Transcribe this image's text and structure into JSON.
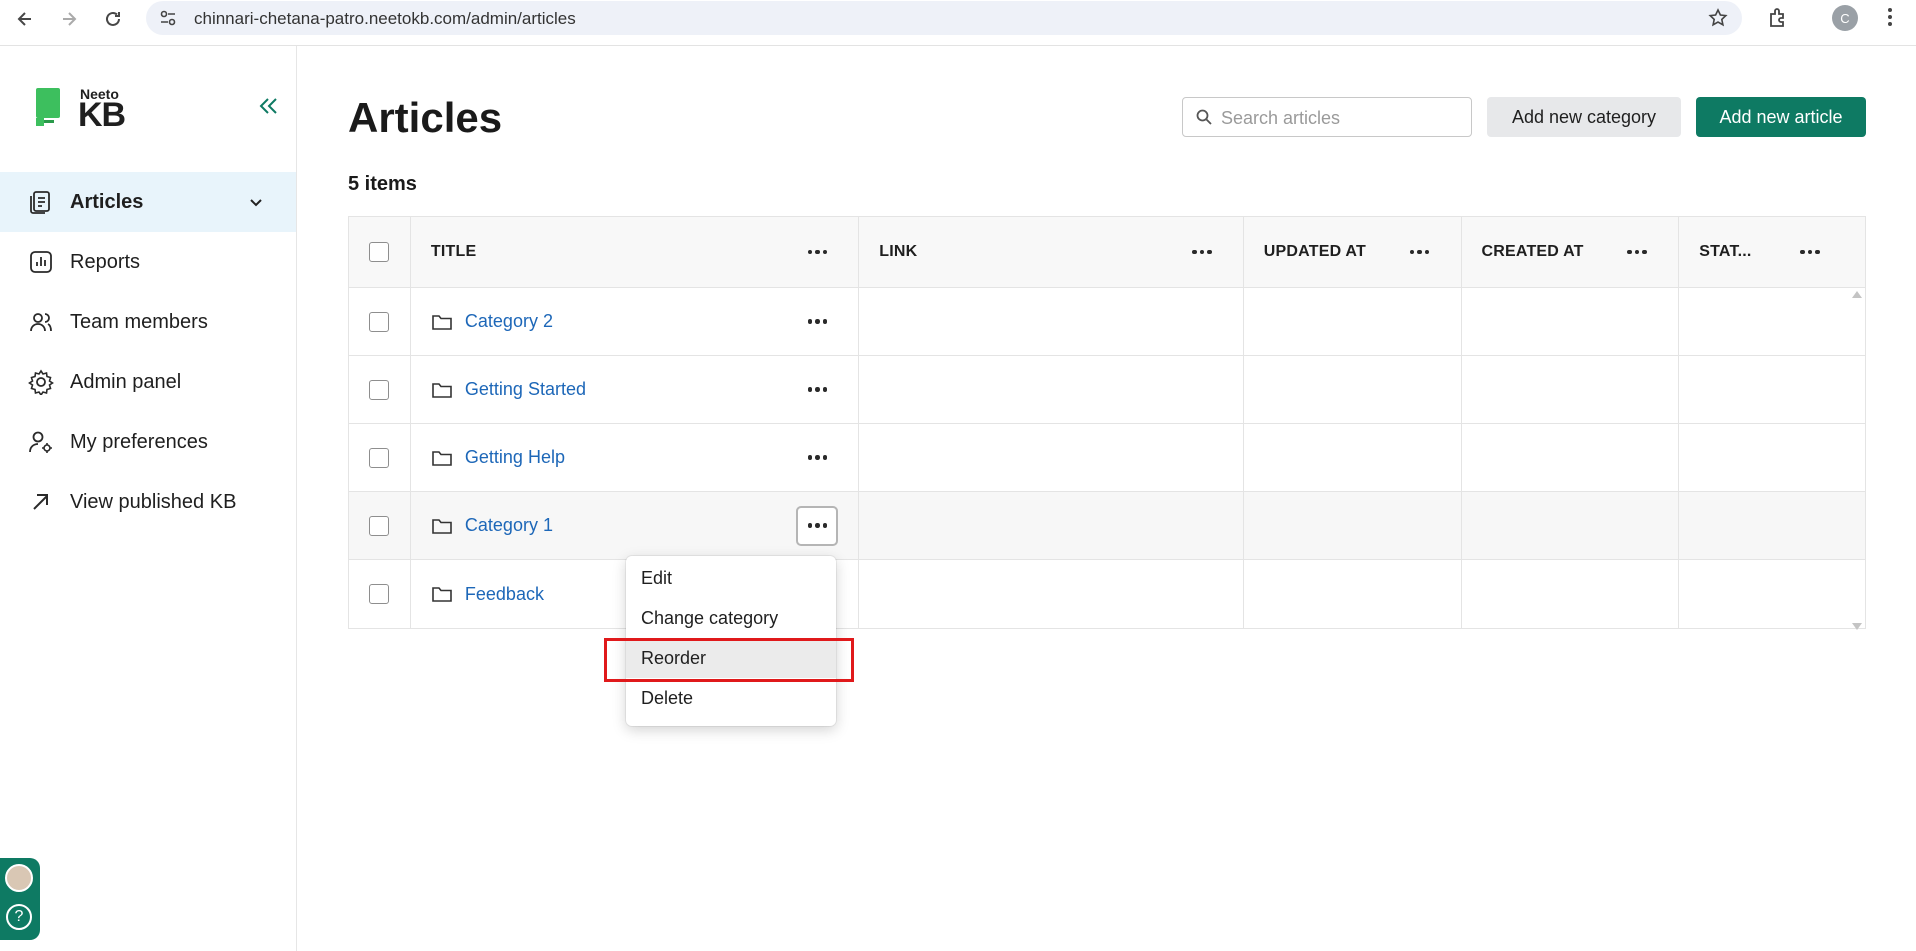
{
  "browser": {
    "url": "chinnari-chetana-patro.neetokb.com/admin/articles",
    "profile_initial": "C"
  },
  "sidebar": {
    "logo_brand": "Neeto",
    "logo_product": "KB",
    "items": [
      {
        "label": "Articles",
        "icon": "articles-icon",
        "active": true
      },
      {
        "label": "Reports",
        "icon": "reports-icon"
      },
      {
        "label": "Team members",
        "icon": "team-icon"
      },
      {
        "label": "Admin panel",
        "icon": "gear-icon"
      },
      {
        "label": "My preferences",
        "icon": "user-settings-icon"
      },
      {
        "label": "View published KB",
        "icon": "external-arrow-icon"
      }
    ],
    "help_label": "?"
  },
  "main": {
    "title": "Articles",
    "search_placeholder": "Search articles",
    "add_category_label": "Add new category",
    "add_article_label": "Add new article",
    "count": "5 items",
    "columns": [
      "TITLE",
      "LINK",
      "UPDATED AT",
      "CREATED AT",
      "STAT..."
    ],
    "rows": [
      {
        "title": "Category 2"
      },
      {
        "title": "Getting Started"
      },
      {
        "title": "Getting Help"
      },
      {
        "title": "Category 1"
      },
      {
        "title": "Feedback"
      }
    ]
  },
  "dropdown": {
    "items": [
      "Edit",
      "Change category",
      "Reorder",
      "Delete"
    ],
    "highlighted": "Reorder"
  },
  "colors": {
    "brand_green": "#0e7a63",
    "link_blue": "#1d67b8",
    "annotation_red": "#e0191b"
  }
}
